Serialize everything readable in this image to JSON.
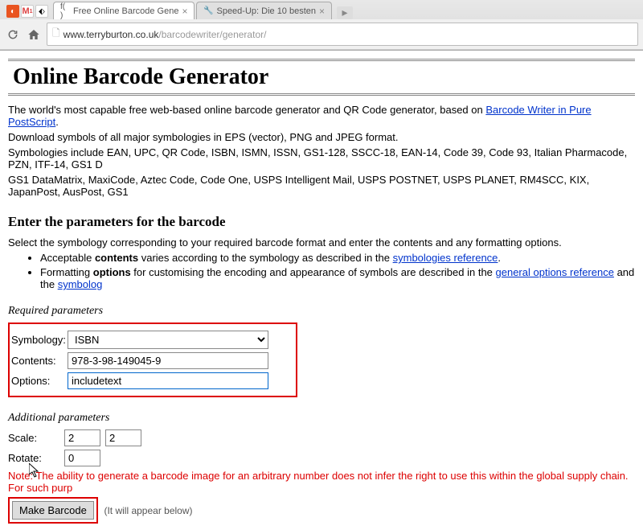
{
  "browser": {
    "tabs": [
      {
        "icon": "f( )",
        "title": "Free Online Barcode Gene"
      },
      {
        "icon": "🔧",
        "title": "Speed-Up: Die 10 besten"
      }
    ],
    "url_host": "www.terryburton.co.uk",
    "url_path": "/barcodewriter/generator/"
  },
  "page": {
    "title": "Online Barcode Generator",
    "intro_pre": "The world's most capable free web-based online barcode generator and QR Code generator, based on ",
    "intro_link": "Barcode Writer in Pure PostScript",
    "intro_post": ".",
    "dl_line": "Download symbols of all major symbologies in EPS (vector), PNG and JPEG format.",
    "sym_line1": "Symbologies include EAN, UPC, QR Code, ISBN, ISMN, ISSN, GS1-128, SSCC-18, EAN-14, Code 39, Code 93, Italian Pharmacode, PZN, ITF-14, GS1 D",
    "sym_line2": "GS1 DataMatrix, MaxiCode, Aztec Code, Code One, USPS Intelligent Mail, USPS POSTNET, USPS PLANET, RM4SCC, KIX, JapanPost, AusPost, GS1",
    "enter_heading": "Enter the parameters for the barcode",
    "select_line": "Select the symbology corresponding to your required barcode format and enter the contents and any formatting options.",
    "bullet1_pre": "Acceptable ",
    "bullet1_bold": "contents",
    "bullet1_mid": " varies according to the symbology as described in the ",
    "bullet1_link": "symbologies reference",
    "bullet1_post": ".",
    "bullet2_pre": "Formatting ",
    "bullet2_bold": "options",
    "bullet2_mid": " for customising the encoding and appearance of symbols are described in the ",
    "bullet2_link": "general options reference",
    "bullet2_mid2": " and the ",
    "bullet2_link2": "symbolog",
    "required_label": "Required parameters",
    "symbology_label": "Symbology:",
    "symbology_value": "ISBN",
    "contents_label": "Contents:",
    "contents_value": "978-3-98-149045-9",
    "options_label": "Options:",
    "options_value": "includetext",
    "additional_label": "Additional parameters",
    "scale_label": "Scale:",
    "scale_x": "2",
    "scale_y": "2",
    "rotate_label": "Rotate:",
    "rotate_value": "0",
    "note": "Note: The ability to generate a barcode image for an arbitrary number does not infer the right to use this within the global supply chain. For such purp",
    "make_btn": "Make Barcode",
    "appear": "(It will appear below)"
  }
}
